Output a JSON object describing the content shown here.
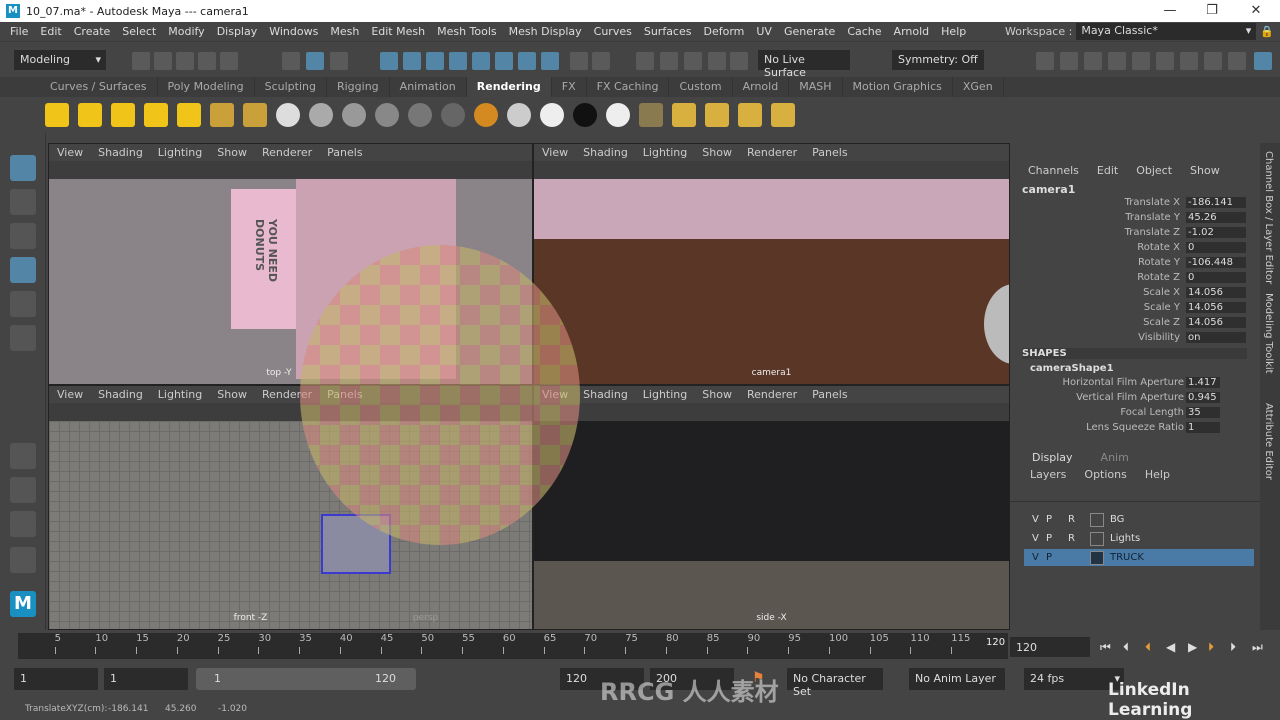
{
  "window": {
    "title": "10_07.ma* - Autodesk Maya  ---  camera1",
    "min": "—",
    "max": "❐",
    "close": "✕"
  },
  "menus": [
    "File",
    "Edit",
    "Create",
    "Select",
    "Modify",
    "Display",
    "Windows",
    "Mesh",
    "Edit Mesh",
    "Mesh Tools",
    "Mesh Display",
    "Curves",
    "Surfaces",
    "Deform",
    "UV",
    "Generate",
    "Cache",
    "Arnold",
    "Help"
  ],
  "workspace": {
    "label": "Workspace :",
    "value": "Maya Classic*"
  },
  "statusline": {
    "mode": "Modeling",
    "live_surface": "No Live Surface",
    "symmetry": "Symmetry: Off"
  },
  "shelf_tabs": [
    "Curves / Surfaces",
    "Poly Modeling",
    "Sculpting",
    "Rigging",
    "Animation",
    "Rendering",
    "FX",
    "FX Caching",
    "Custom",
    "Arnold",
    "MASH",
    "Motion Graphics",
    "XGen"
  ],
  "shelf_active": "Rendering",
  "viewport_menu": [
    "View",
    "Shading",
    "Lighting",
    "Show",
    "Renderer",
    "Panels"
  ],
  "viewports": {
    "top": "top -Y",
    "camera": "camera1",
    "front": "front -Z",
    "persp": "persp",
    "side": "side -X"
  },
  "scene_text": "YOU NEED DONUTS",
  "channelbox": {
    "menu": [
      "Channels",
      "Edit",
      "Object",
      "Show"
    ],
    "object": "camera1",
    "channels": [
      {
        "name": "Translate X",
        "value": "-186.141"
      },
      {
        "name": "Translate Y",
        "value": "45.26"
      },
      {
        "name": "Translate Z",
        "value": "-1.02"
      },
      {
        "name": "Rotate X",
        "value": "0"
      },
      {
        "name": "Rotate Y",
        "value": "-106.448"
      },
      {
        "name": "Rotate Z",
        "value": "0"
      },
      {
        "name": "Scale X",
        "value": "14.056"
      },
      {
        "name": "Scale Y",
        "value": "14.056"
      },
      {
        "name": "Scale Z",
        "value": "14.056"
      },
      {
        "name": "Visibility",
        "value": "on"
      }
    ],
    "shapes_header": "SHAPES",
    "shape": "cameraShape1",
    "shape_channels": [
      {
        "name": "Horizontal Film Aperture",
        "value": "1.417"
      },
      {
        "name": "Vertical Film Aperture",
        "value": "0.945"
      },
      {
        "name": "Focal Length",
        "value": "35"
      },
      {
        "name": "Lens Squeeze Ratio",
        "value": "1"
      }
    ]
  },
  "layer_editor": {
    "tabs": [
      "Display",
      "Anim"
    ],
    "menu": [
      "Layers",
      "Options",
      "Help"
    ],
    "layers": [
      {
        "v": "V",
        "p": "P",
        "r": "R",
        "name": "BG",
        "selected": false
      },
      {
        "v": "V",
        "p": "P",
        "r": "R",
        "name": "Lights",
        "selected": false
      },
      {
        "v": "V",
        "p": "P",
        "r": "",
        "name": "TRUCK",
        "selected": true
      }
    ]
  },
  "side_tabs": [
    "Channel Box / Layer Editor",
    "Modeling Toolkit",
    "Attribute Editor"
  ],
  "timeline": {
    "ticks": [
      5,
      10,
      15,
      20,
      25,
      30,
      35,
      40,
      45,
      50,
      55,
      60,
      65,
      70,
      75,
      80,
      85,
      90,
      95,
      100,
      105,
      110,
      115
    ],
    "current_frame": "120",
    "current_field": "120",
    "start": 1,
    "end": 120
  },
  "range": {
    "start": "1",
    "playback_start": "1",
    "range_start": "1",
    "range_end": "120",
    "playback_end": "120",
    "end": "200",
    "character_set": "No Character Set",
    "anim_layer": "No Anim Layer",
    "fps": "24 fps"
  },
  "help_line": {
    "label": "TranslateXYZ(cm):",
    "x": "-186.141",
    "y": "45.260",
    "z": "-1.020"
  },
  "watermark": {
    "brand": "LinkedIn Learning",
    "text": "RRCG 人人素材"
  },
  "colors": {
    "selection": "#5285a6",
    "panel": "#444444",
    "field": "#2b2b2b",
    "layer_selected": "#4a7ba7"
  }
}
